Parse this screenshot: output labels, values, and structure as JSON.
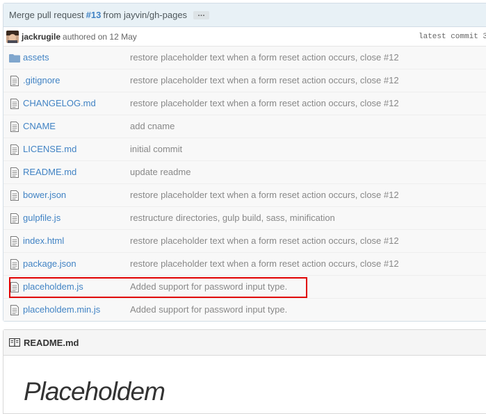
{
  "commit": {
    "message_prefix": "Merge pull request",
    "pr_number": "#13",
    "message_suffix": "from jayvin/gh-pages",
    "ellipsis": "…",
    "author": "jackrugile",
    "authored_text": "authored on 12 May",
    "latest_commit": "latest commit 3"
  },
  "files": [
    {
      "type": "folder",
      "name": "assets",
      "message": "restore placeholder text when a form reset action occurs, close #12"
    },
    {
      "type": "file",
      "name": ".gitignore",
      "message": "restore placeholder text when a form reset action occurs, close #12"
    },
    {
      "type": "file",
      "name": "CHANGELOG.md",
      "message": "restore placeholder text when a form reset action occurs, close #12"
    },
    {
      "type": "file",
      "name": "CNAME",
      "message": "add cname"
    },
    {
      "type": "file",
      "name": "LICENSE.md",
      "message": "initial commit"
    },
    {
      "type": "file",
      "name": "README.md",
      "message": "update readme"
    },
    {
      "type": "file",
      "name": "bower.json",
      "message": "restore placeholder text when a form reset action occurs, close #12"
    },
    {
      "type": "file",
      "name": "gulpfile.js",
      "message": "restructure directories, gulp build, sass, minification"
    },
    {
      "type": "file",
      "name": "index.html",
      "message": "restore placeholder text when a form reset action occurs, close #12"
    },
    {
      "type": "file",
      "name": "package.json",
      "message": "restore placeholder text when a form reset action occurs, close #12"
    },
    {
      "type": "file",
      "name": "placeholdem.js",
      "message": "Added support for password input type."
    },
    {
      "type": "file",
      "name": "placeholdem.min.js",
      "message": "Added support for password input type."
    }
  ],
  "highlighted_file": "placeholdem.js",
  "readme": {
    "header": "README.md",
    "title": "Placeholdem"
  },
  "colors": {
    "link": "#4183c4",
    "header_bg": "#e8f1f6",
    "highlight_border": "#e00000"
  }
}
